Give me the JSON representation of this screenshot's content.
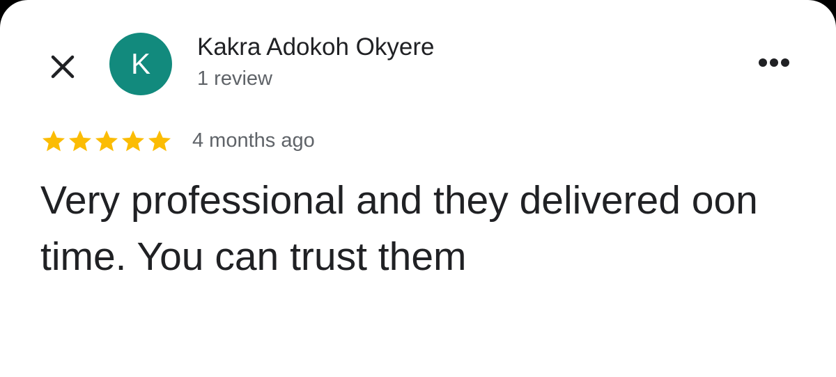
{
  "colors": {
    "avatar_bg": "#128a7d",
    "star": "#fbbc04",
    "primary_text": "#202124",
    "secondary_text": "#5f6368"
  },
  "header": {
    "close_icon": "close-icon",
    "more_icon": "more-horizontal-icon"
  },
  "reviewer": {
    "initial": "K",
    "name": "Kakra Adokoh Okyere",
    "review_count": "1 review"
  },
  "review": {
    "rating": 5,
    "rating_max": 5,
    "time": "4 months ago",
    "text": "Very professional and they delivered oon time. You can trust them"
  }
}
